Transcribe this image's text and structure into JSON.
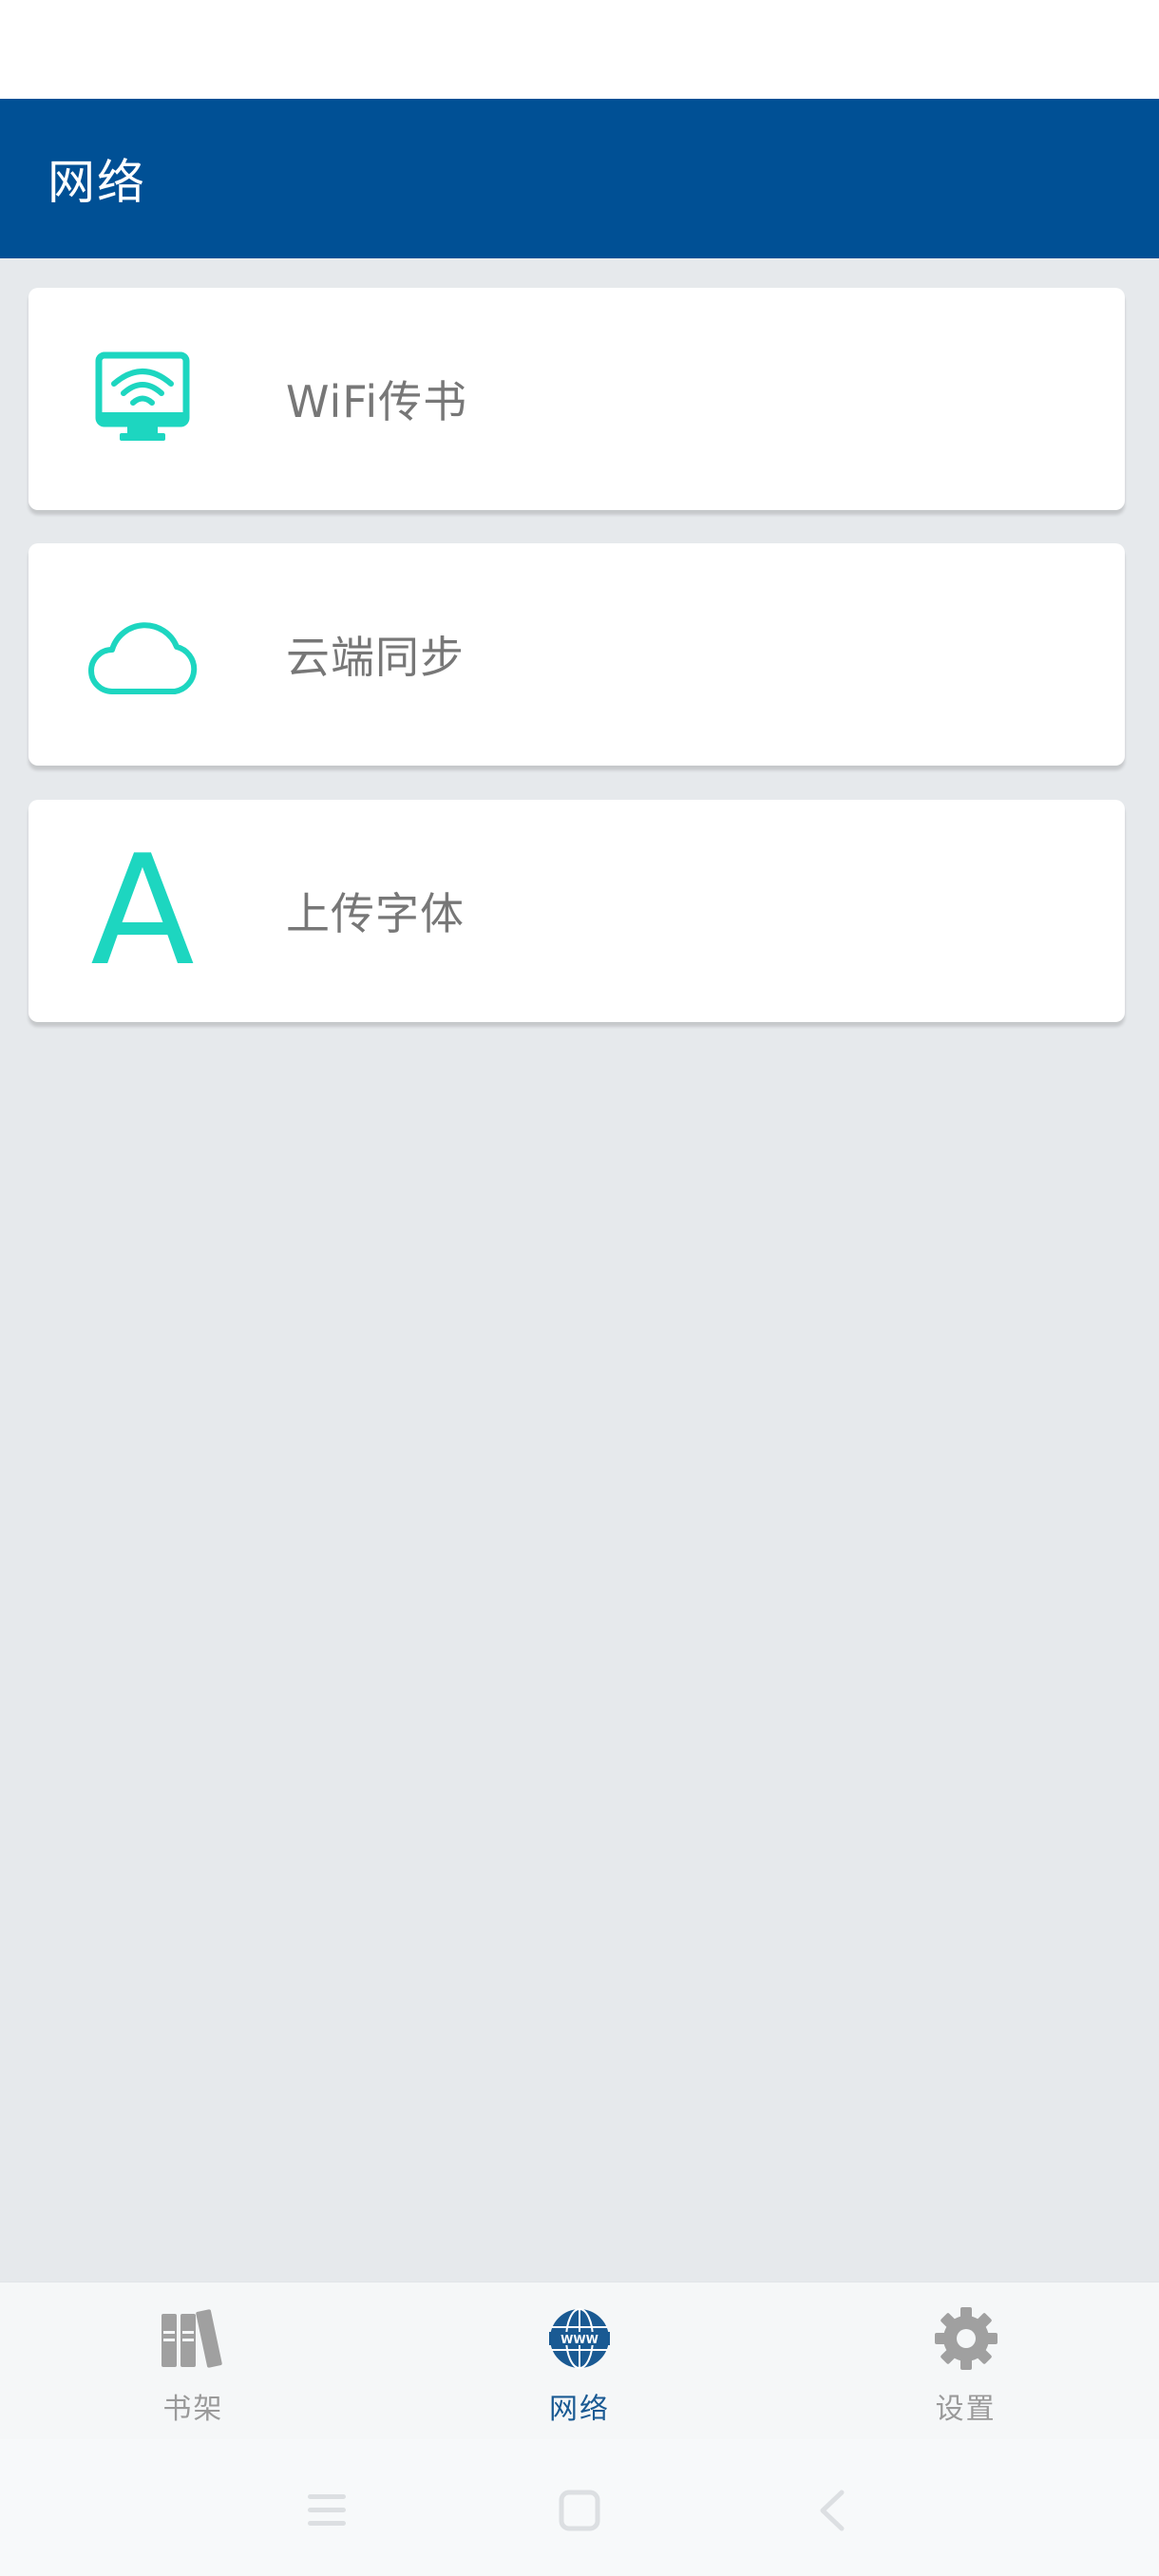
{
  "header": {
    "title": "网络"
  },
  "menu": {
    "items": [
      {
        "label": "WiFi传书",
        "icon": "wifi-monitor-icon"
      },
      {
        "label": "云端同步",
        "icon": "cloud-icon"
      },
      {
        "label": "上传字体",
        "icon": "letter-a-icon",
        "glyph": "A"
      }
    ]
  },
  "bottom_nav": {
    "items": [
      {
        "label": "书架",
        "icon": "bookshelf-icon",
        "active": false
      },
      {
        "label": "网络",
        "icon": "www-globe-icon",
        "active": true
      },
      {
        "label": "设置",
        "icon": "gear-icon",
        "active": false
      }
    ]
  },
  "system_nav": {
    "buttons": [
      "menu-icon",
      "home-icon",
      "back-icon"
    ]
  },
  "colors": {
    "primary": "#005095",
    "accent": "#1dd6c0",
    "background": "#e6e9ec",
    "active_nav": "#1a5a93",
    "inactive_nav": "#9a9a9a"
  }
}
